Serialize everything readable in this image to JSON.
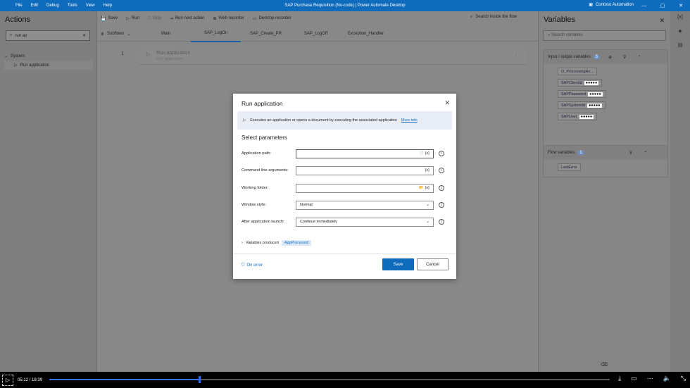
{
  "window": {
    "title": "SAP Purchase Requisition (No-code) | Power Automate Desktop",
    "menu": [
      "File",
      "Edit",
      "Debug",
      "Tools",
      "View",
      "Help"
    ],
    "org": "Contoso Automation",
    "controls": [
      "—",
      "▢",
      "✕"
    ]
  },
  "left": {
    "title": "Actions",
    "search_value": "run ap",
    "tree_group": "System",
    "tree_item": "Run application"
  },
  "toolbar": {
    "items": [
      "Save",
      "Run",
      "Stop",
      "Run next action",
      "Web recorder",
      "Desktop recorder"
    ],
    "search_flow": "Search inside the flow"
  },
  "tabs": {
    "subflows": "Subflows",
    "items": [
      "Main",
      "SAP_LogOn",
      "SAP_Create_PR",
      "SAP_LogOff",
      "Exception_Handler"
    ],
    "active": 1
  },
  "step": {
    "number": "1",
    "title": "Run application",
    "subtitle": "Run application"
  },
  "right": {
    "title": "Variables",
    "search_placeholder": "Search variables",
    "io_title": "Input / output variables",
    "io_count": "5",
    "io_vars": [
      {
        "name": "O_ProcessingRe...",
        "value": ""
      },
      {
        "name": "SAPClientId",
        "value": "●●●●●"
      },
      {
        "name": "SAPPassword",
        "value": "●●●●●"
      },
      {
        "name": "SAPSystemId",
        "value": "●●●●●"
      },
      {
        "name": "SAPUser",
        "value": "●●●●●"
      }
    ],
    "flow_title": "Flow variables",
    "flow_count": "1",
    "flow_vars": [
      "LastError"
    ]
  },
  "modal": {
    "title": "Run application",
    "info": "Executes an application or opens a document by executing the associated application",
    "info_link": "More info",
    "section": "Select parameters",
    "fields": [
      {
        "label": "Application path:",
        "value": "",
        "icons": "📄 {x}"
      },
      {
        "label": "Command line arguments:",
        "value": "",
        "icons": "{x}"
      },
      {
        "label": "Working folder:",
        "value": "",
        "icons": "📂 {x}"
      },
      {
        "label": "Window style:",
        "value": "Normal",
        "icons": "⌄"
      },
      {
        "label": "After application launch:",
        "value": "Continue immediately",
        "icons": "⌄"
      }
    ],
    "vars_produced": "Variables produced",
    "var_badge": "AppProcessId",
    "on_error": "On error",
    "save": "Save",
    "cancel": "Cancel"
  },
  "player": {
    "time": "05:12 / 19:39",
    "progress": 0.268
  }
}
